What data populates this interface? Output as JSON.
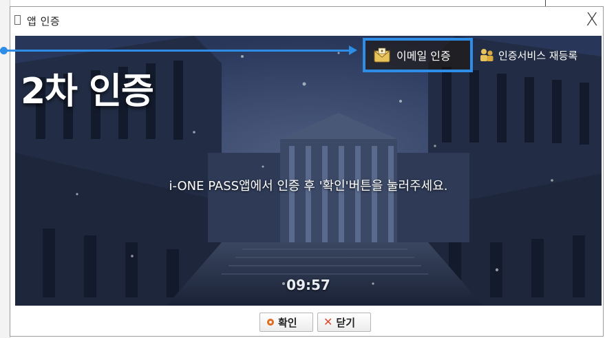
{
  "window": {
    "title": "앱 인증",
    "close_glyph": "X"
  },
  "banner": {
    "heading": "2차 인증",
    "email_auth_label": "이메일 인증",
    "reregister_label": "인증서비스 재등록",
    "message": "i-ONE PASS앱에서 인증 후 '확인'버튼을 눌러주세요.",
    "timer": "09:57"
  },
  "footer": {
    "confirm_label": "확인",
    "close_label": "닫기"
  },
  "icons": {
    "email": "envelope-icon",
    "reregister": "user-pair-icon",
    "confirm": "circle-icon",
    "close": "x-icon"
  },
  "colors": {
    "highlight": "#2e8de6",
    "banner_bg": "#1b2740",
    "confirm_icon": "#e36a1b",
    "close_icon": "#e0462e"
  }
}
